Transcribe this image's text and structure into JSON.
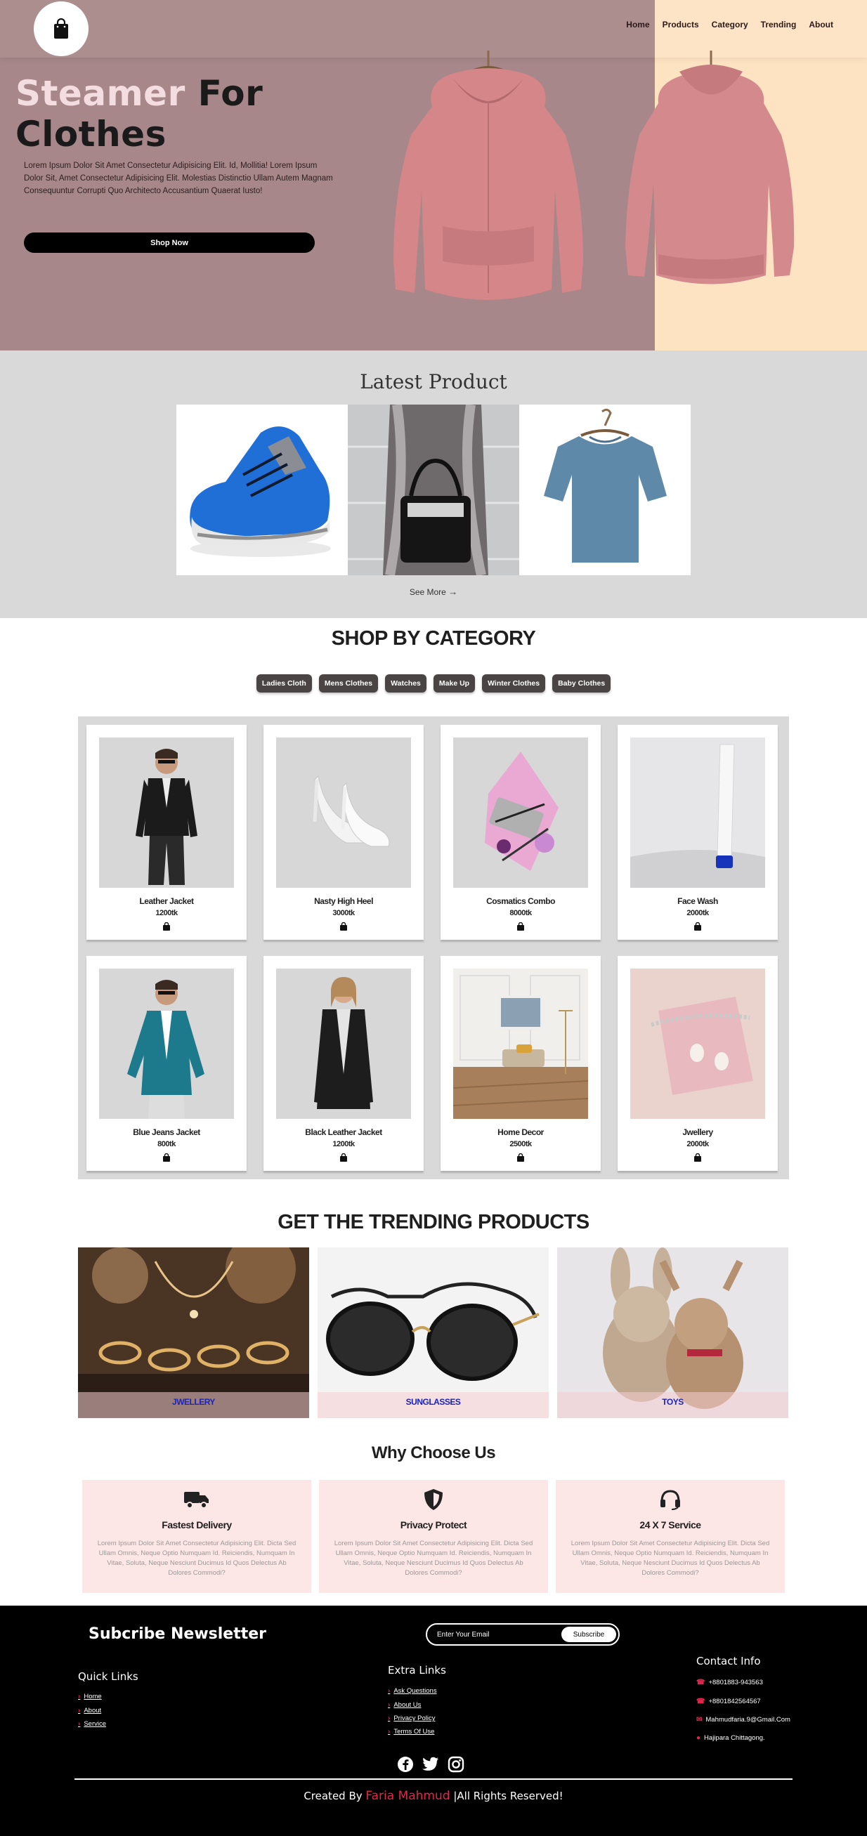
{
  "nav": {
    "links": [
      "Home",
      "Products",
      "Category",
      "Trending",
      "About"
    ]
  },
  "hero": {
    "title_highlight": "Steamer",
    "title_rest_1": " For",
    "title_rest_2": "Clothes",
    "text": "Lorem Ipsum Dolor Sit Amet Consectetur Adipisicing Elit. Id, Mollitia! Lorem Ipsum Dolor Sit, Amet Consectetur Adipisicing Elit. Molestias Distinctio Ullam Autem Magnam Consequuntur Corrupti Quo Architecto Accusantium Quaerat Iusto!",
    "button": "Shop Now"
  },
  "latest": {
    "title": "Latest Product",
    "see_more": "See More",
    "images": [
      "sneaker",
      "handbag",
      "tshirt"
    ]
  },
  "category": {
    "title": "SHOP BY CATEGORY",
    "pills": [
      "Ladies Cloth",
      "Mens Clothes",
      "Watches",
      "Make Up",
      "Winter Clothes",
      "Baby Clothes"
    ],
    "products": [
      {
        "name": "Leather Jacket",
        "price": "1200tk"
      },
      {
        "name": "Nasty High Heel",
        "price": "3000tk"
      },
      {
        "name": "Cosmatics Combo",
        "price": "8000tk"
      },
      {
        "name": "Face Wash",
        "price": "2000tk"
      },
      {
        "name": "Blue Jeans Jacket",
        "price": "800tk"
      },
      {
        "name": "Black Leather Jacket",
        "price": "1200tk"
      },
      {
        "name": "Home Decor",
        "price": "2500tk"
      },
      {
        "name": "Jwellery",
        "price": "2000tk"
      }
    ]
  },
  "trending": {
    "title": "GET THE TRENDING PRODUCTS",
    "items": [
      "JWELLERY",
      "SUNGLASSES",
      "TOYS"
    ]
  },
  "why": {
    "title": "Why Choose Us",
    "items": [
      {
        "icon": "truck-icon",
        "title": "Fastest Delivery",
        "text": "Lorem Ipsum Dolor Sit Amet Consectetur Adipisicing Elit. Dicta Sed Ullam Omnis, Neque Optio Numquam Id. Reiciendis, Numquam In Vitae, Soluta, Neque Nesciunt Ducimus Id Quos Delectus Ab Dolores Commodi?"
      },
      {
        "icon": "shield-icon",
        "title": "Privacy Protect",
        "text": "Lorem Ipsum Dolor Sit Amet Consectetur Adipisicing Elit. Dicta Sed Ullam Omnis, Neque Optio Numquam Id. Reiciendis, Numquam In Vitae, Soluta, Neque Nesciunt Ducimus Id Quos Delectus Ab Dolores Commodi?"
      },
      {
        "icon": "headset-icon",
        "title": "24 X 7 Service",
        "text": "Lorem Ipsum Dolor Sit Amet Consectetur Adipisicing Elit. Dicta Sed Ullam Omnis, Neque Optio Numquam Id. Reiciendis, Numquam In Vitae, Soluta, Neque Nesciunt Ducimus Id Quos Delectus Ab Dolores Commodi?"
      }
    ]
  },
  "footer": {
    "newsletter_title": "Subcribe Newsletter",
    "email_placeholder": "Enter Your Email",
    "subscribe": "Subscribe",
    "quick_links_title": "Quick Links",
    "quick_links": [
      "Home",
      "About",
      "Service"
    ],
    "extra_links_title": "Extra Links",
    "extra_links": [
      "Ask Questions",
      "About Us",
      "Privacy Policy",
      "Terms Of Use"
    ],
    "contact_title": "Contact Info",
    "contacts": [
      "+8801883-943563",
      "+8801842564567",
      "Mahmudfaria.9@Gmail.Com",
      "Hajipara Chittagong."
    ],
    "credit_prefix": "Created By ",
    "credit_name": "Faria Mahmud",
    "credit_suffix": " |All Rights Reserved!",
    "accent": "#e0264c"
  },
  "colors": {
    "hero_bg": "#a78789",
    "hero_right": "#fee3c3",
    "section_gray": "#d9d9d9",
    "pill": "#4a4444",
    "why_card": "#fde6e6"
  }
}
